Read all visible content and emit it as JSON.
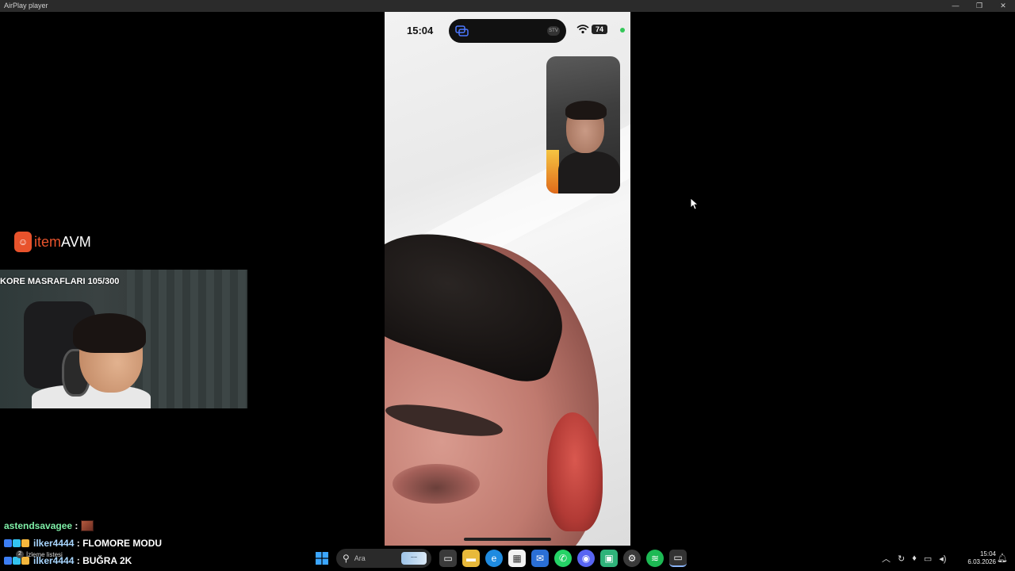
{
  "window": {
    "title": "AirPlay player",
    "minimize": "—",
    "maximize": "❐",
    "close": "✕"
  },
  "phone": {
    "time": "15:04",
    "battery": "74",
    "island_tag": "STV"
  },
  "overlay": {
    "logo_item": "item",
    "logo_avm": "AVM",
    "webcam_caption": "KORE MASRAFLARI 105/300"
  },
  "chat": [
    {
      "user": "astendsavagee",
      "message": ""
    },
    {
      "user": "ilker4444",
      "message": "FLOMORE MODU"
    },
    {
      "user": "ilker4444",
      "message": "BUĞRA 2K"
    }
  ],
  "watch_list": {
    "label": "İzleme listesi",
    "count": "2"
  },
  "taskbar": {
    "search_placeholder": "Ara",
    "icons": [
      "windows-start",
      "search",
      "task-view",
      "file-explorer",
      "edge",
      "microsoft-store",
      "mail",
      "whatsapp",
      "discord",
      "app-green",
      "steam",
      "spotify",
      "airplay-player"
    ]
  },
  "system_tray": {
    "time": "15:04",
    "date": "6.03.2026"
  }
}
